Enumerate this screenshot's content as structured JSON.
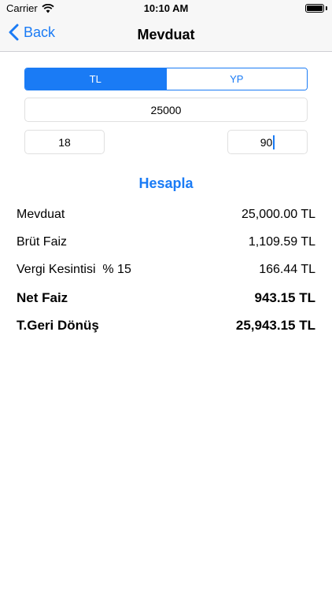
{
  "status_bar": {
    "carrier": "Carrier",
    "time": "10:10 AM"
  },
  "nav": {
    "back_label": "Back",
    "title": "Mevduat"
  },
  "currency_segments": [
    {
      "label": "TL",
      "selected": true
    },
    {
      "label": "YP",
      "selected": false
    }
  ],
  "inputs": {
    "amount": "25000",
    "days": "18",
    "rate": "90"
  },
  "calculate_label": "Hesapla",
  "results": [
    {
      "label": "Mevduat",
      "value": "25,000.00 TL"
    },
    {
      "label": "Brüt Faiz",
      "value": "1,109.59 TL"
    },
    {
      "label": "Vergi Kesintisi  % 15",
      "value": "166.44 TL"
    },
    {
      "label": "Net Faiz",
      "value": "943.15 TL"
    },
    {
      "label": "T.Geri Dönüş",
      "value": "25,943.15 TL"
    }
  ],
  "colors": {
    "accent": "#1a7bf5"
  }
}
